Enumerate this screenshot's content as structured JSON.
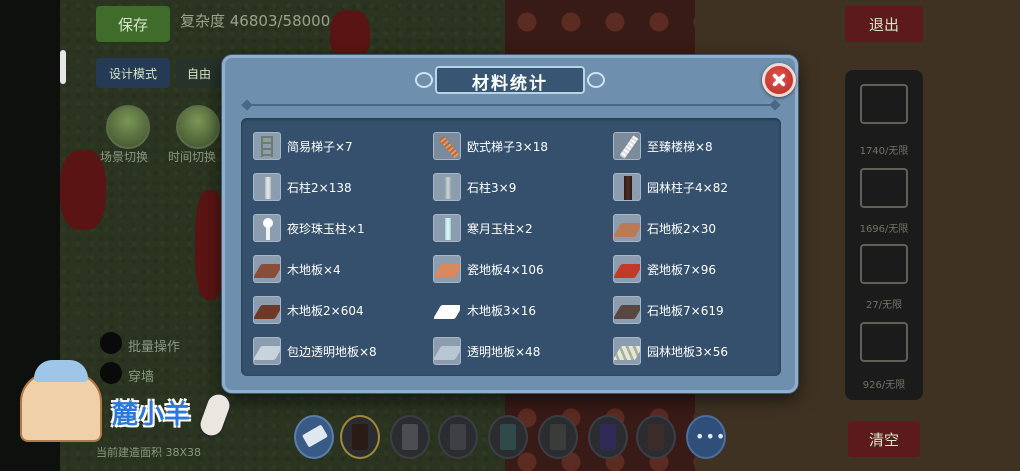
{
  "background": {
    "top_left_buttons": [
      "保存",
      "设计模式",
      "自由"
    ],
    "complexity": "复杂度 46803/58000",
    "exit": "退出",
    "round_buttons": [
      "场景切换",
      "时间切换"
    ],
    "options": [
      "批量操作",
      "穿墙"
    ],
    "bottom_area": "当前建造面积 38X38",
    "clear": "清空",
    "side_counts": [
      "1740/无限",
      "1696/无限",
      "27/无限",
      "926/无限"
    ]
  },
  "dialog": {
    "title": "材料统计",
    "close_icon": "close-icon",
    "accent_colors": {
      "frame": "#6e8fae",
      "panel": "#34506c",
      "close": "#d0433b"
    },
    "items": [
      {
        "label": "简易梯子×7",
        "icon": "simple-ladder-icon"
      },
      {
        "label": "欧式梯子3×18",
        "icon": "euro-ladder-icon"
      },
      {
        "label": "至臻楼梯×8",
        "icon": "premium-stairs-icon"
      },
      {
        "label": "石柱2×138",
        "icon": "stone-pillar-icon"
      },
      {
        "label": "石柱3×9",
        "icon": "stone-pillar-icon"
      },
      {
        "label": "园林柱子4×82",
        "icon": "garden-pillar-icon"
      },
      {
        "label": "夜珍珠玉柱×1",
        "icon": "pearl-pillar-icon"
      },
      {
        "label": "寒月玉柱×2",
        "icon": "jade-pillar-icon"
      },
      {
        "label": "石地板2×30",
        "icon": "stone-floor-icon"
      },
      {
        "label": "木地板×4",
        "icon": "wood-floor-icon"
      },
      {
        "label": "瓷地板4×106",
        "icon": "porcelain-floor-icon"
      },
      {
        "label": "瓷地板7×96",
        "icon": "porcelain-floor-icon"
      },
      {
        "label": "木地板2×604",
        "icon": "wood-floor-icon"
      },
      {
        "label": "木地板3×16",
        "icon": "white-floor-icon"
      },
      {
        "label": "石地板7×619",
        "icon": "stone-floor-icon"
      },
      {
        "label": "包边透明地板×8",
        "icon": "glass-floor-icon"
      },
      {
        "label": "透明地板×48",
        "icon": "glass-floor-icon"
      },
      {
        "label": "园林地板3×56",
        "icon": "garden-floor-icon"
      }
    ]
  },
  "watermark": {
    "text": "麓小羊"
  }
}
